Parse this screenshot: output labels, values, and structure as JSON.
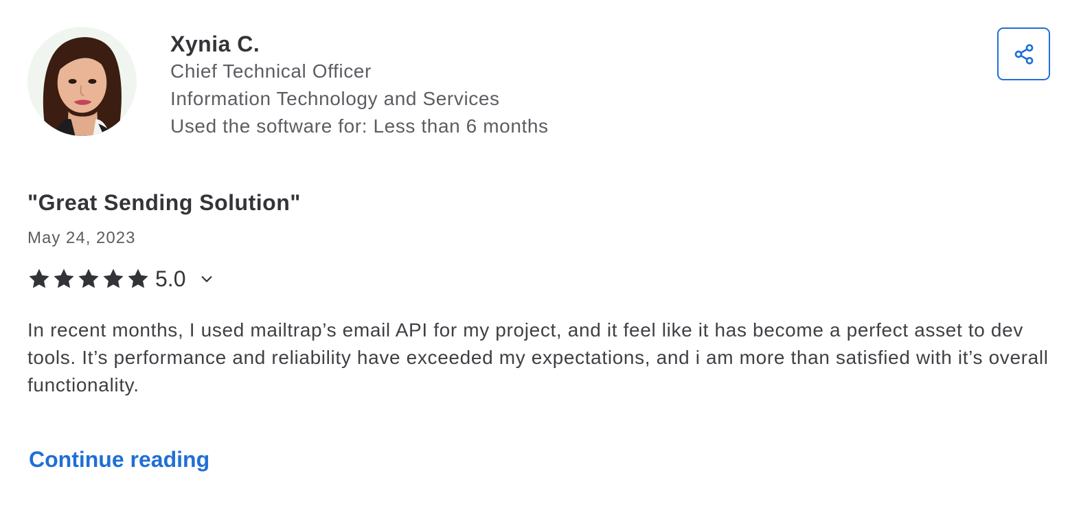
{
  "reviewer": {
    "avatar_icon": "reviewer-photo",
    "name": "Xynia C.",
    "job_title": "Chief Technical Officer",
    "industry": "Information Technology and Services",
    "usage_duration": "Used the software for: Less than 6 months"
  },
  "share": {
    "icon": "share-icon",
    "color": "#1f6fd6"
  },
  "review": {
    "title": "\"Great Sending Solution\"",
    "date": "May 24, 2023",
    "rating": {
      "stars_filled": 5,
      "stars_total": 5,
      "value": "5.0",
      "toggle_icon": "chevron-down-icon"
    },
    "body": "In recent months, I used mailtrap’s email API for my project, and it feel like it has become a perfect asset to dev tools. It’s performance and reliability have exceeded my expectations, and i am more than satisfied with it’s overall functionality.",
    "continue_label": "Continue reading"
  },
  "colors": {
    "accent": "#1f6fd6",
    "text_dark": "#333438",
    "text_muted": "#5c5d62",
    "star": "#333438"
  }
}
